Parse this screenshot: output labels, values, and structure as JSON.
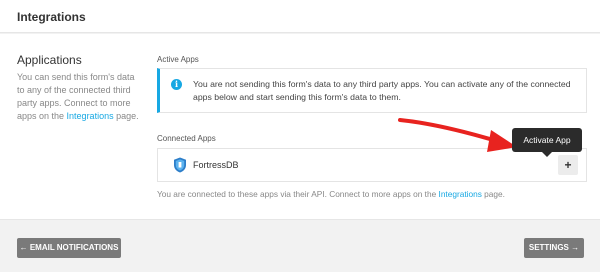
{
  "header": {
    "title": "Integrations"
  },
  "sidebar": {
    "heading": "Applications",
    "desc_before": "You can send this form's data to any of the connected third party apps. Connect to more apps on the ",
    "link": "Integrations",
    "desc_after": " page."
  },
  "active_apps": {
    "label": "Active Apps",
    "notice_icon": "info-icon",
    "notice": "You are not sending this form's data to any third party apps. You can activate any of the connected apps below and start sending this form's data to them."
  },
  "connected_apps": {
    "label": "Connected Apps",
    "apps": [
      {
        "name": "FortressDB",
        "icon": "shield-icon",
        "action": "+"
      }
    ],
    "tooltip": "Activate App"
  },
  "footer_note": {
    "before": "You are connected to these apps via their API. Connect to more apps on the ",
    "link": "Integrations",
    "after": " page."
  },
  "buttons": {
    "back": "← EMAIL NOTIFICATIONS",
    "next": "SETTINGS →"
  },
  "colors": {
    "accent": "#17a8e3",
    "arrow": "#e8231f",
    "button_bg": "#7a7a7a",
    "tooltip_bg": "#2b2b2b"
  }
}
